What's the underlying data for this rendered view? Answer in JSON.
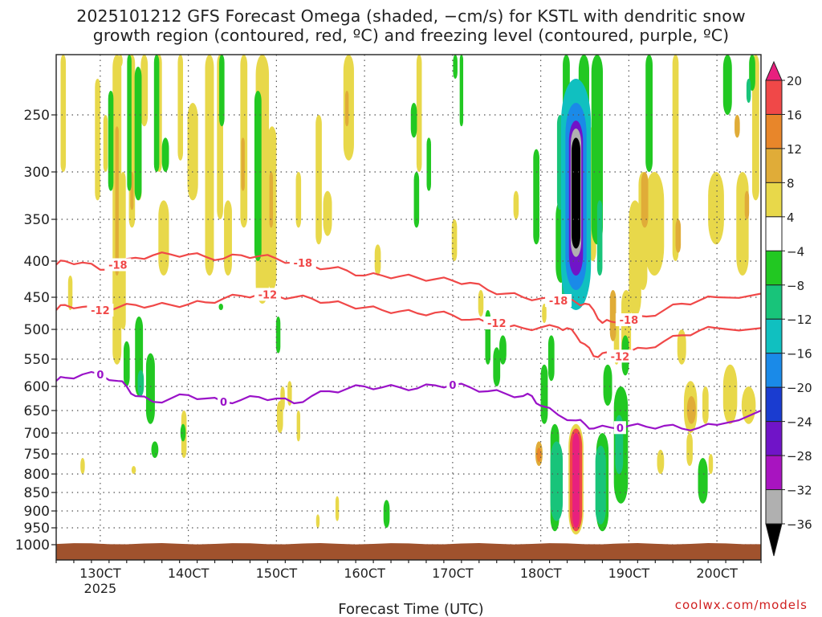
{
  "header": {
    "title_line1": "2025101212 GFS Forecast Omega (shaded, −cm/s) for KSTL with dendritic snow",
    "title_line2": "growth region (contoured, red, ºC) and freezing level (contoured, purple, ºC)"
  },
  "footer": {
    "credit": "coolwx.com/models"
  },
  "colors": {
    "dendritic": "#f04848",
    "freezing": "#9a12c8",
    "ground": "#a0522d",
    "grid": "#555555"
  },
  "chart_data": {
    "type": "heatmap",
    "title": "2025101212 GFS Forecast Omega (shaded, −cm/s) for KSTL with dendritic snow growth region (contoured, red, ºC) and freezing level (contoured, purple, ºC)",
    "xlabel": "Forecast Time (UTC)",
    "ylabel": "",
    "x_unit": "hours from 2025-10-12 12Z",
    "x_range": [
      -5,
      75
    ],
    "x_ticks": [
      {
        "x": 0,
        "label": "130CT"
      },
      {
        "x": 10,
        "label": "140CT"
      },
      {
        "x": 20,
        "label": "150CT"
      },
      {
        "x": 30,
        "label": "160CT"
      },
      {
        "x": 40,
        "label": "170CT"
      },
      {
        "x": 50,
        "label": "180CT"
      },
      {
        "x": 60,
        "label": "190CT"
      },
      {
        "x": 70,
        "label": "200CT"
      }
    ],
    "year_label": "2025",
    "y_scale": "pressure (reversed)",
    "y_range": [
      1000,
      200
    ],
    "y_ticks": [
      250,
      300,
      350,
      400,
      450,
      500,
      550,
      600,
      650,
      700,
      750,
      800,
      850,
      900,
      950,
      1000
    ],
    "grid": true,
    "colorbar": {
      "levels": [
        20,
        16,
        12,
        8,
        4,
        -4,
        -8,
        -12,
        -16,
        -20,
        -24,
        -28,
        -32,
        -36
      ],
      "colors": [
        "#e8207e",
        "#f04848",
        "#e8862a",
        "#e0ac38",
        "#e8d84a",
        "#ffffff",
        "#22c822",
        "#18c47a",
        "#10c0c0",
        "#1a8ae8",
        "#1a3cd0",
        "#7014c8",
        "#a814c0",
        "#b0b0b0",
        "#000000"
      ]
    },
    "contours": [
      {
        "name": "-18",
        "color": "red",
        "x": [
          -5,
          -4,
          -2,
          0,
          2,
          4,
          6,
          8,
          10,
          12,
          14,
          16,
          18,
          20,
          22,
          24,
          26,
          28,
          30,
          32,
          34,
          36,
          38,
          40,
          42,
          44,
          46,
          48,
          50,
          52,
          53,
          54,
          55,
          56,
          57,
          58,
          60,
          62,
          64,
          66,
          68,
          70,
          75
        ],
        "p": [
          405,
          400,
          402,
          412,
          405,
          396,
          393,
          392,
          392,
          395,
          397,
          393,
          394,
          397,
          402,
          406,
          410,
          413,
          420,
          420,
          421,
          423,
          425,
          427,
          430,
          440,
          445,
          450,
          452,
          455,
          456,
          458,
          460,
          470,
          490,
          488,
          485,
          480,
          470,
          460,
          455,
          450,
          445
        ]
      },
      {
        "name": "-12",
        "color": "red",
        "x": [
          -5,
          -4,
          -2,
          0,
          2,
          4,
          6,
          8,
          10,
          12,
          14,
          16,
          18,
          20,
          22,
          24,
          26,
          28,
          30,
          32,
          34,
          36,
          38,
          40,
          42,
          44,
          46,
          48,
          50,
          52,
          53,
          54,
          55,
          56,
          57,
          58,
          60,
          62,
          64,
          66,
          68,
          70,
          75
        ],
        "p": [
          470,
          462,
          465,
          470,
          466,
          462,
          463,
          462,
          461,
          458,
          452,
          448,
          446,
          448,
          450,
          452,
          458,
          462,
          466,
          470,
          472,
          475,
          474,
          478,
          485,
          490,
          497,
          498,
          497,
          497,
          498,
          510,
          525,
          545,
          540,
          545,
          538,
          532,
          520,
          510,
          502,
          498,
          498
        ]
      },
      {
        "name": "0",
        "color": "purple",
        "x": [
          -5,
          -4,
          -2,
          0,
          2,
          3,
          4,
          6,
          8,
          10,
          12,
          14,
          16,
          18,
          20,
          22,
          24,
          26,
          28,
          30,
          32,
          34,
          36,
          38,
          40,
          42,
          44,
          46,
          48,
          49,
          50,
          52,
          54,
          55,
          56,
          58,
          60,
          62,
          64,
          66,
          68,
          70,
          75
        ],
        "p": [
          590,
          584,
          578,
          578,
          590,
          600,
          620,
          632,
          625,
          618,
          625,
          632,
          628,
          622,
          625,
          635,
          620,
          610,
          605,
          600,
          602,
          602,
          604,
          598,
          597,
          602,
          610,
          615,
          620,
          620,
          640,
          660,
          672,
          680,
          690,
          688,
          684,
          686,
          684,
          690,
          688,
          682,
          650
        ]
      }
    ],
    "omega_features": [
      {
        "x": 54.0,
        "p_top": 270,
        "p_bottom": 385,
        "value": "<-36"
      },
      {
        "x": 54.0,
        "p_top": 690,
        "p_bottom": 960,
        "value": ">20"
      },
      {
        "x": 52.5,
        "p_top": 730,
        "p_bottom": 960,
        "value": "-12"
      },
      {
        "x": 58.5,
        "p_top": 620,
        "p_bottom": 890,
        "value": "-12"
      }
    ]
  }
}
